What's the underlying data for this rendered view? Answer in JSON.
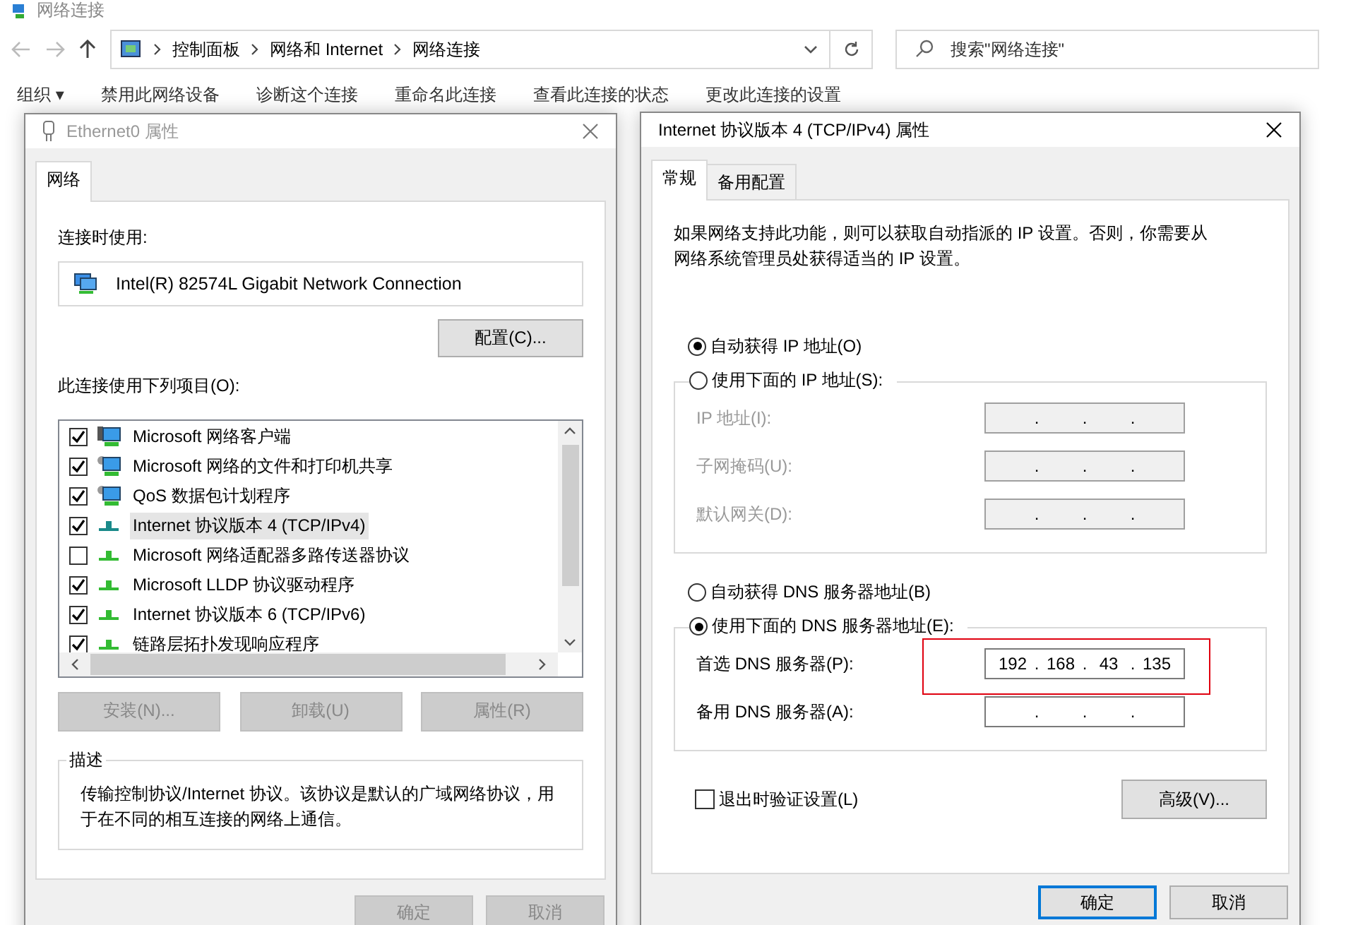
{
  "explorer": {
    "title": "网络连接",
    "breadcrumbs": [
      "控制面板",
      "网络和 Internet",
      "网络连接"
    ],
    "search": {
      "placeholder": "搜索\"网络连接\""
    },
    "toolbar": [
      "组织 ▾",
      "禁用此网络设备",
      "诊断这个连接",
      "重命名此连接",
      "查看此连接的状态",
      "更改此连接的设置"
    ]
  },
  "adapter_dialog": {
    "title": "Ethernet0 属性",
    "tabs": [
      {
        "label": "网络",
        "selected": true
      }
    ],
    "connect_using_label": "连接时使用:",
    "adapter": "Intel(R) 82574L Gigabit Network Connection",
    "configure_button": "配置(C)...",
    "items_label": "此连接使用下列项目(O):",
    "items": [
      {
        "label": "Microsoft 网络客户端",
        "kind": "client",
        "checked": true,
        "selected": false
      },
      {
        "label": "Microsoft 网络的文件和打印机共享",
        "kind": "service",
        "checked": true,
        "selected": false
      },
      {
        "label": "QoS 数据包计划程序",
        "kind": "service",
        "checked": true,
        "selected": false
      },
      {
        "label": "Internet 协议版本 4 (TCP/IPv4)",
        "kind": "protocol",
        "checked": true,
        "selected": true
      },
      {
        "label": "Microsoft 网络适配器多路传送器协议",
        "kind": "protocol",
        "checked": false,
        "selected": false
      },
      {
        "label": "Microsoft LLDP 协议驱动程序",
        "kind": "protocol",
        "checked": true,
        "selected": false
      },
      {
        "label": "Internet 协议版本 6 (TCP/IPv6)",
        "kind": "protocol",
        "checked": true,
        "selected": false
      },
      {
        "label": "链路层拓扑发现响应程序",
        "kind": "protocol",
        "checked": true,
        "selected": false
      }
    ],
    "item_buttons": [
      {
        "label": "安装(N)...",
        "disabled": true
      },
      {
        "label": "卸载(U)",
        "disabled": true
      },
      {
        "label": "属性(R)",
        "disabled": true
      }
    ],
    "description": {
      "title": "描述",
      "text": "传输控制协议/Internet 协议。该协议是默认的广域网络协议，用于在不同的相互连接的网络上通信。"
    },
    "buttons": [
      {
        "label": "确定",
        "disabled": true
      },
      {
        "label": "取消",
        "disabled": true
      }
    ]
  },
  "ipv4_dialog": {
    "title": "Internet 协议版本 4 (TCP/IPv4) 属性",
    "tabs": [
      {
        "label": "常规",
        "selected": true
      },
      {
        "label": "备用配置",
        "selected": false
      }
    ],
    "intro": "如果网络支持此功能，则可以获取自动指派的 IP 设置。否则，你需要从网络系统管理员处获得适当的 IP 设置。",
    "octet_separator": ".",
    "ip_modes": [
      {
        "label": "自动获得 IP 地址(O)",
        "selected": true
      },
      {
        "label": "使用下面的 IP 地址(S):",
        "selected": false
      }
    ],
    "ip_fields": [
      {
        "label": "IP 地址(I):",
        "disabled": true
      },
      {
        "label": "子网掩码(U):",
        "disabled": true
      },
      {
        "label": "默认网关(D):",
        "disabled": true
      }
    ],
    "dns_modes": [
      {
        "label": "自动获得 DNS 服务器地址(B)",
        "selected": false
      },
      {
        "label": "使用下面的 DNS 服务器地址(E):",
        "selected": true
      }
    ],
    "dns_fields": [
      {
        "label": "首选 DNS 服务器(P):",
        "disabled": false,
        "highlighted": true,
        "octets": [
          "192",
          "168",
          "43",
          "135"
        ]
      },
      {
        "label": "备用 DNS 服务器(A):",
        "disabled": false,
        "highlighted": false
      }
    ],
    "validate": {
      "label": "退出时验证设置(L)",
      "checked": false
    },
    "advanced_button": "高级(V)...",
    "buttons": [
      {
        "label": "确定",
        "focused": true
      },
      {
        "label": "取消",
        "focused": false
      }
    ]
  }
}
